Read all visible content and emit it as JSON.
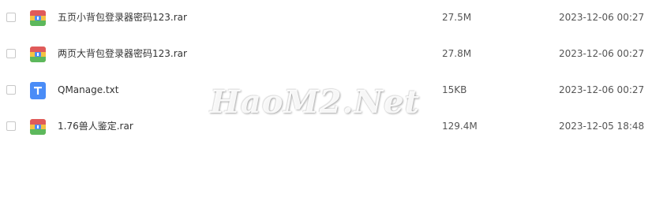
{
  "files": [
    {
      "name": "五页小背包登录器密码123.rar",
      "size": "27.5M",
      "modified": "2023-12-06 00:27",
      "icon": "rar-archive-icon"
    },
    {
      "name": "两页大背包登录器密码123.rar",
      "size": "27.8M",
      "modified": "2023-12-06 00:27",
      "icon": "rar-archive-icon"
    },
    {
      "name": "QManage.txt",
      "size": "15KB",
      "modified": "2023-12-06 00:27",
      "icon": "text-file-icon"
    },
    {
      "name": "1.76兽人鉴定.rar",
      "size": "129.4M",
      "modified": "2023-12-05 18:48",
      "icon": "rar-archive-icon"
    }
  ],
  "watermark": "HaoM2.Net",
  "colors": {
    "text_icon": "#4a8cf7",
    "archive_red": "#e05a5a",
    "archive_yellow": "#f4c243",
    "archive_green": "#5cb85c",
    "archive_blue": "#4a8cf7"
  }
}
